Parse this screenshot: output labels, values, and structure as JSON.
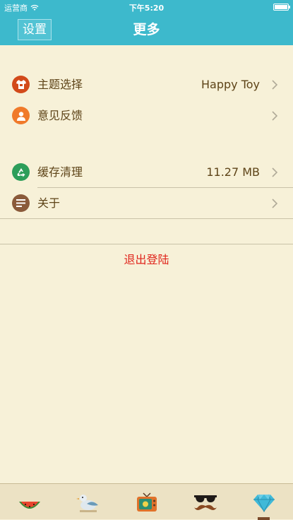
{
  "status_bar": {
    "carrier": "运营商",
    "time": "下午5:20"
  },
  "nav": {
    "left_button": "设置",
    "title": "更多"
  },
  "menu": {
    "theme": {
      "label": "主题选择",
      "value": "Happy Toy",
      "icon": "tshirt-icon",
      "color": "#d24a1a"
    },
    "feedback": {
      "label": "意见反馈",
      "icon": "user-icon",
      "color": "#f07a2a"
    },
    "cache": {
      "label": "缓存清理",
      "value": "11.27 MB",
      "icon": "recycle-icon",
      "color": "#2d9e5a"
    },
    "about": {
      "label": "关于",
      "icon": "document-icon",
      "color": "#8a5a3a"
    }
  },
  "logout": {
    "label": "退出登陆",
    "color": "#e0251c"
  },
  "tabbar": {
    "items": [
      {
        "icon": "watermelon-icon"
      },
      {
        "icon": "bird-icon"
      },
      {
        "icon": "tv-icon"
      },
      {
        "icon": "sunglasses-mustache-icon"
      },
      {
        "icon": "diamond-icon",
        "active": true
      }
    ]
  },
  "colors": {
    "header": "#3db9cc",
    "background": "#f7f1d8",
    "text": "#5e4418"
  }
}
